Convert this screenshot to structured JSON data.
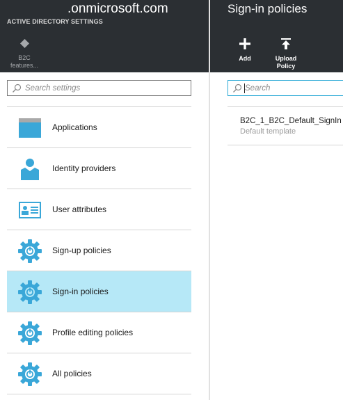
{
  "left_blade": {
    "title": ".onmicrosoft.com",
    "subtitle": "ACTIVE DIRECTORY SETTINGS",
    "commands": {
      "b2c_features": {
        "icon": "diamond-icon",
        "label_line1": "B2C",
        "label_line2": "features..."
      }
    },
    "search": {
      "placeholder": "Search settings",
      "value": ""
    },
    "items": [
      {
        "label": "Applications",
        "icon": "applications-icon",
        "selected": false
      },
      {
        "label": "Identity providers",
        "icon": "identity-providers-icon",
        "selected": false
      },
      {
        "label": "User attributes",
        "icon": "user-attributes-icon",
        "selected": false
      },
      {
        "label": "Sign-up policies",
        "icon": "policy-gear-icon",
        "selected": false
      },
      {
        "label": "Sign-in policies",
        "icon": "policy-gear-icon",
        "selected": true
      },
      {
        "label": "Profile editing policies",
        "icon": "policy-gear-icon",
        "selected": false
      },
      {
        "label": "All policies",
        "icon": "policy-gear-icon",
        "selected": false
      }
    ]
  },
  "right_blade": {
    "title": "Sign-in policies",
    "commands": {
      "add": {
        "icon": "plus-icon",
        "label": "Add"
      },
      "upload": {
        "icon": "upload-icon",
        "label_line1": "Upload",
        "label_line2": "Policy"
      }
    },
    "search": {
      "placeholder": "Search",
      "value": ""
    },
    "policies": [
      {
        "name": "B2C_1_B2C_Default_SignIn",
        "description": "Default template"
      }
    ]
  },
  "colors": {
    "header_bg": "#2b2f33",
    "accent_blue": "#3aa7d8",
    "selected_bg": "#b6e8f7",
    "search_focus_border": "#2aa9d6"
  }
}
